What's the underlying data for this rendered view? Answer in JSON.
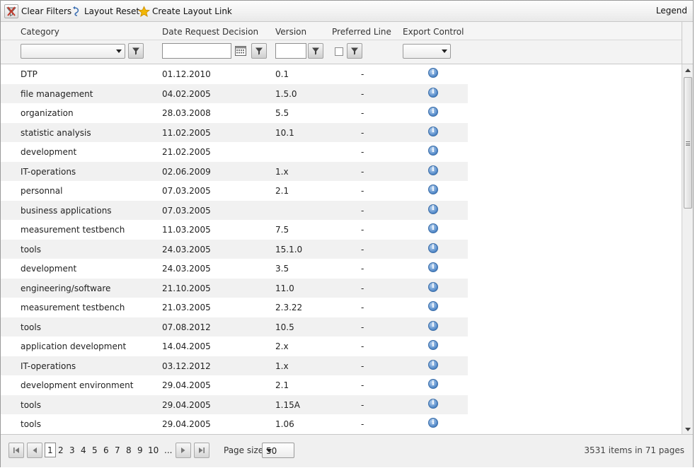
{
  "toolbar": {
    "clear_filters": "Clear Filters",
    "layout_reset": "Layout Reset",
    "create_layout_link": "Create Layout Link",
    "legend": "Legend"
  },
  "columns": {
    "category": "Category",
    "date_request_decision": "Date Request Decision",
    "version": "Version",
    "preferred_line": "Preferred Line",
    "export_control": "Export Control"
  },
  "filters": {
    "category_value": "",
    "date_value": "",
    "version_value": "",
    "preferred_line_checked": false,
    "export_control_value": ""
  },
  "rows": [
    {
      "category": "DTP",
      "date": "01.12.2010",
      "version": "0.1",
      "preferred": "-"
    },
    {
      "category": "file management",
      "date": "04.02.2005",
      "version": "1.5.0",
      "preferred": "-"
    },
    {
      "category": "organization",
      "date": "28.03.2008",
      "version": "5.5",
      "preferred": "-"
    },
    {
      "category": "statistic analysis",
      "date": "11.02.2005",
      "version": "10.1",
      "preferred": "-"
    },
    {
      "category": "development",
      "date": "21.02.2005",
      "version": "",
      "preferred": "-"
    },
    {
      "category": "IT-operations",
      "date": "02.06.2009",
      "version": "1.x",
      "preferred": "-"
    },
    {
      "category": "personnal",
      "date": "07.03.2005",
      "version": "2.1",
      "preferred": "-"
    },
    {
      "category": "business applications",
      "date": "07.03.2005",
      "version": "",
      "preferred": "-"
    },
    {
      "category": "measurement testbench",
      "date": "11.03.2005",
      "version": "7.5",
      "preferred": "-"
    },
    {
      "category": "tools",
      "date": "24.03.2005",
      "version": "15.1.0",
      "preferred": "-"
    },
    {
      "category": "development",
      "date": "24.03.2005",
      "version": "3.5",
      "preferred": "-"
    },
    {
      "category": "engineering/software",
      "date": "21.10.2005",
      "version": "11.0",
      "preferred": "-"
    },
    {
      "category": "measurement testbench",
      "date": "21.03.2005",
      "version": "2.3.22",
      "preferred": "-"
    },
    {
      "category": "tools",
      "date": "07.08.2012",
      "version": "10.5",
      "preferred": "-"
    },
    {
      "category": "application development",
      "date": "14.04.2005",
      "version": "2.x",
      "preferred": "-"
    },
    {
      "category": "IT-operations",
      "date": "03.12.2012",
      "version": "1.x",
      "preferred": "-"
    },
    {
      "category": "development environment",
      "date": "29.04.2005",
      "version": "2.1",
      "preferred": "-"
    },
    {
      "category": "tools",
      "date": "29.04.2005",
      "version": "1.15A",
      "preferred": "-"
    },
    {
      "category": "tools",
      "date": "29.04.2005",
      "version": "1.06",
      "preferred": "-"
    }
  ],
  "pager": {
    "pages": [
      "1",
      "2",
      "3",
      "4",
      "5",
      "6",
      "7",
      "8",
      "9",
      "10",
      "..."
    ],
    "current_page": "1",
    "page_size_label": "Page size:",
    "page_size_value": "50",
    "summary": "3531 items in 71 pages"
  },
  "icons": {
    "clear_filters": "clear-filters-icon",
    "layout_reset": "layout-reset-icon",
    "create_layout_link": "star-icon",
    "filter": "funnel-icon",
    "calendar": "calendar-icon",
    "info": "info-icon"
  },
  "colors": {
    "row_alt": "#f1f1f1",
    "info_icon": "#4f86c6",
    "star": "#f2b705"
  }
}
